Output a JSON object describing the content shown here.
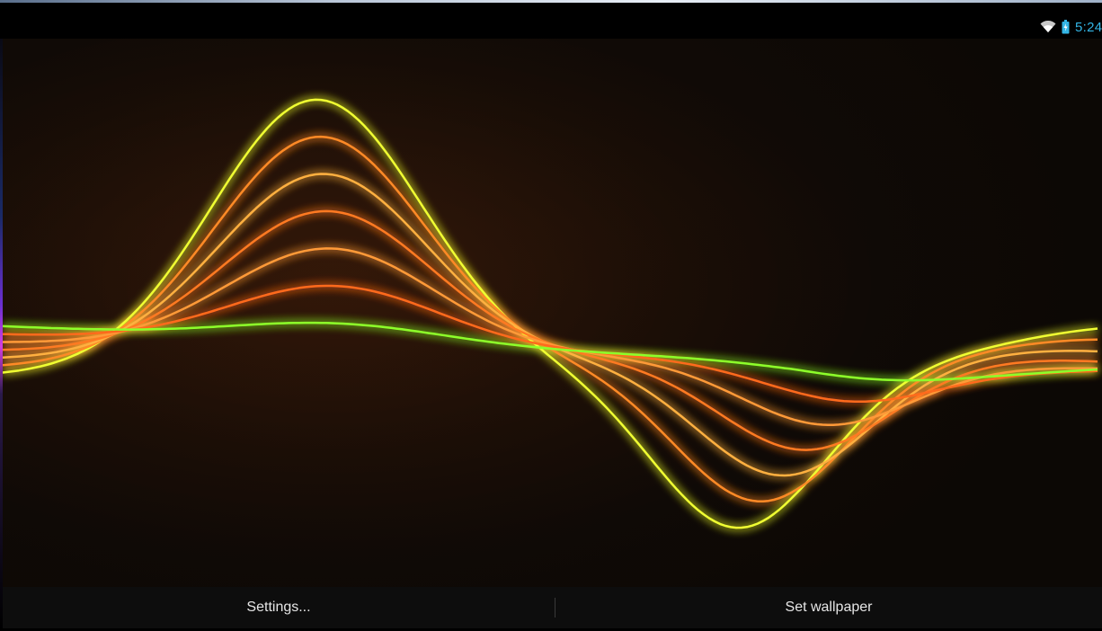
{
  "status_bar": {
    "time": "5:24",
    "icons": [
      "wifi-icon",
      "battery-icon"
    ],
    "accent_color": "#33b5e5"
  },
  "wallpaper": {
    "wave_colors": [
      "#f0ff30",
      "#ff8a28",
      "#ffb040",
      "#ff7a22",
      "#ff9a38",
      "#ff6a1e",
      "#8dff2a"
    ]
  },
  "actions": {
    "settings_label": "Settings...",
    "set_wallpaper_label": "Set wallpaper"
  }
}
